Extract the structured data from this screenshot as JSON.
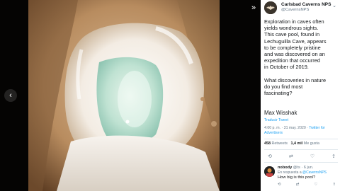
{
  "account": {
    "name": "Carlsbad Caverns NPS",
    "handle": "@CavernsNPS"
  },
  "tweet": {
    "text": "Exploration in caves often\nyields wondrous sights.\nThis cave pool, found in\nLechuguilla Cave, appears\nto be completely pristine\nand was discovered on an\nexpedition that occurred\nin October of 2019.\n\nWhat discoveries in nature\ndo you find most\nfascinating?",
    "author": "Max Wisshak",
    "translate": "Traducir Tweet",
    "time_date": "4:00 p. m. · 31 may. 2020 · ",
    "source": "Twitter for Advertisers",
    "retweets": "458",
    "retweets_label": "Retweets",
    "likes": "1,4 mil",
    "likes_label": "Me gusta"
  },
  "reply": {
    "name": "nobody",
    "handle": "@ts",
    "date": "· 6 jun.",
    "reply_prefix": "En respuesta a",
    "reply_to": "@CavernsNPS",
    "text": "How big is this pool?"
  },
  "icons": {
    "prev": "‹",
    "collapse": "»",
    "chevron": "⌄",
    "reply": "⟲",
    "retweet": "⇄",
    "like": "♡",
    "share": "⇪"
  },
  "colors": {
    "accent": "#1da1f2",
    "muted": "#657786",
    "text": "#14171a",
    "viewer_bg": "#000000"
  }
}
